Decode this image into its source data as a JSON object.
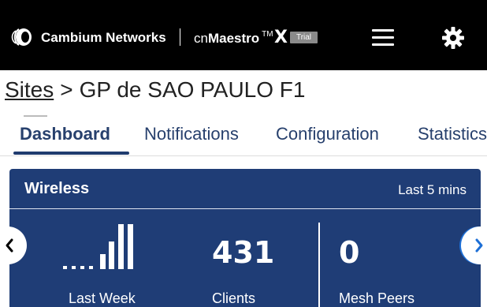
{
  "header": {
    "brand": "Cambium Networks",
    "product_prefix": "cn",
    "product_name": "Maestro",
    "trademark": "TM",
    "product_suffix": "X",
    "trial_badge": "Trial",
    "icons": [
      "cambium-logo-icon",
      "menu-icon",
      "gear-icon"
    ]
  },
  "breadcrumb": {
    "parent": "Sites",
    "separator": ">",
    "current": "GP de SAO PAULO F1"
  },
  "tabs": [
    {
      "label": "Dashboard",
      "active": true
    },
    {
      "label": "Notifications",
      "active": false
    },
    {
      "label": "Configuration",
      "active": false
    },
    {
      "label": "Statistics",
      "active": false
    }
  ],
  "wireless_card": {
    "title": "Wireless",
    "range": "Last 5 mins",
    "stats": [
      {
        "label": "Last Week",
        "value": null,
        "icon": "signal-bars-icon"
      },
      {
        "label": "Clients",
        "value": "431"
      },
      {
        "label": "Mesh Peers",
        "value": "0"
      }
    ]
  },
  "colors": {
    "header_bg": "#000000",
    "card_bg": "#1f3d76",
    "tab_text": "#27406d",
    "accent_blue": "#1d6fd6"
  }
}
